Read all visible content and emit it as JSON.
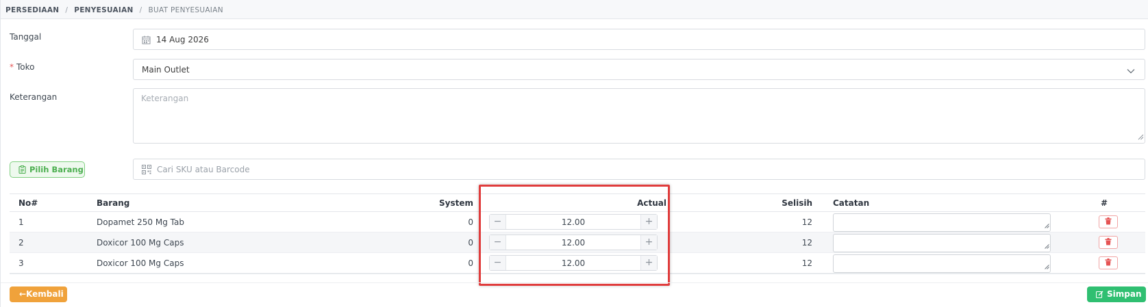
{
  "breadcrumb": {
    "items": [
      "PERSEDIAAN",
      "PENYESUAIAN"
    ],
    "current": "BUAT PENYESUAIAN",
    "separator": "/"
  },
  "form": {
    "tanggal_label": "Tanggal",
    "tanggal_value": "14 Aug 2026",
    "toko_required_mark": "*",
    "toko_label": "Toko",
    "toko_value": "Main Outlet",
    "keterangan_label": "Keterangan",
    "keterangan_placeholder": "Keterangan",
    "pilih_barang_label": "Pilih Barang",
    "search_placeholder": "Cari SKU atau Barcode"
  },
  "table": {
    "headers": {
      "no": "No#",
      "barang": "Barang",
      "system": "System",
      "actual": "Actual",
      "selisih": "Selisih",
      "catatan": "Catatan",
      "action": "#"
    },
    "rows": [
      {
        "no": "1",
        "barang": "Dopamet 250 Mg Tab",
        "system": "0",
        "actual": "12.00",
        "selisih": "12",
        "catatan": ""
      },
      {
        "no": "2",
        "barang": "Doxicor 100 Mg Caps",
        "system": "0",
        "actual": "12.00",
        "selisih": "12",
        "catatan": ""
      },
      {
        "no": "3",
        "barang": "Doxicor 100 Mg Caps",
        "system": "0",
        "actual": "12.00",
        "selisih": "12",
        "catatan": ""
      }
    ],
    "stepper_minus": "−",
    "stepper_plus": "+"
  },
  "footer": {
    "back_label": "←Kembali",
    "save_label": "Simpan"
  },
  "icons": {
    "date": "calendar-icon",
    "select": "chevron-down-icon",
    "search": "qr-code-icon",
    "pilih": "clipboard-icon",
    "delete": "trash-icon",
    "save": "edit-icon"
  },
  "colors": {
    "primary_success": "#2fbf71",
    "warning": "#f0a23b",
    "danger": "#e55353",
    "highlight": "#e03c3c",
    "pilih_green": "#4caf50"
  }
}
